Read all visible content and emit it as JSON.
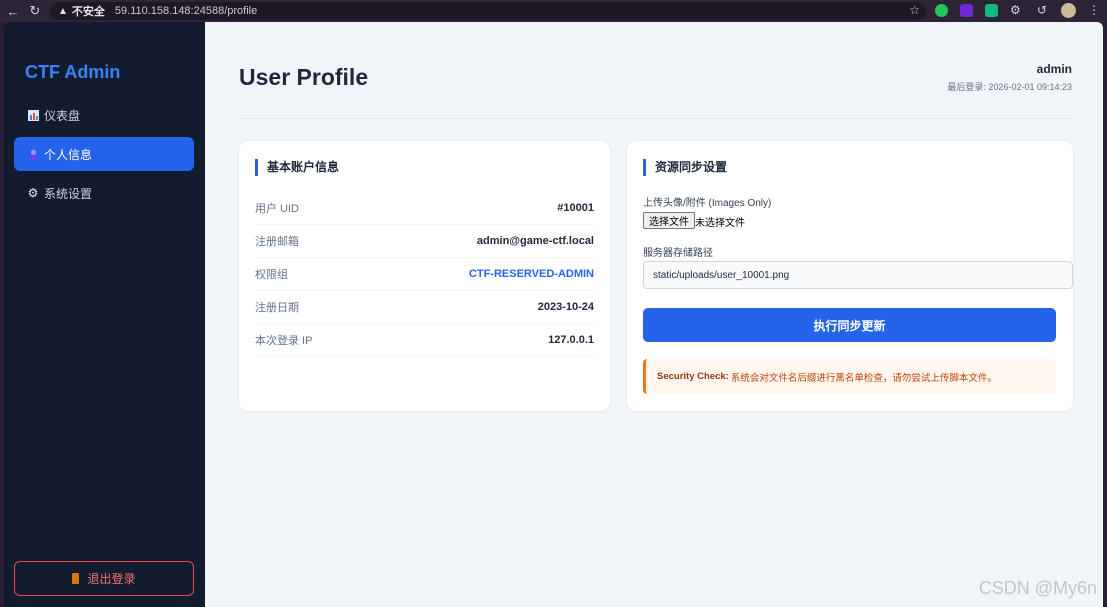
{
  "browser": {
    "insecure_label": "不安全",
    "url": "59.110.158.148:24588/profile"
  },
  "sidebar": {
    "brand": "CTF Admin",
    "items": [
      {
        "label": "仪表盘"
      },
      {
        "label": "个人信息"
      },
      {
        "label": "系统设置"
      }
    ],
    "logout_label": "退出登录"
  },
  "header": {
    "title": "User Profile",
    "username": "admin",
    "last_login": "最后登录: 2026-02-01 09:14:23"
  },
  "account_card": {
    "title": "基本账户信息",
    "rows": [
      {
        "label": "用户 UID",
        "value": "#10001"
      },
      {
        "label": "注册邮箱",
        "value": "admin@game-ctf.local"
      },
      {
        "label": "权限组",
        "value": "CTF-RESERVED-ADMIN"
      },
      {
        "label": "注册日期",
        "value": "2023-10-24"
      },
      {
        "label": "本次登录 IP",
        "value": "127.0.0.1"
      }
    ]
  },
  "sync_card": {
    "title": "资源同步设置",
    "upload_label": "上传头像/附件 (Images Only)",
    "file_button": "选择文件",
    "file_status": "未选择文件",
    "path_label": "服务器存储路径",
    "path_value": "static/uploads/user_10001.png",
    "submit_label": "执行同步更新",
    "security_title": "Security Check:",
    "security_text": "系统会对文件名后缀进行黑名单检查，请勿尝试上传脚本文件。"
  },
  "watermark": "CSDN @My6n",
  "colors": {
    "accent": "#2563eb",
    "sidebar_bg": "#131b2e",
    "warning": "#f97316",
    "danger": "#ef4444"
  }
}
